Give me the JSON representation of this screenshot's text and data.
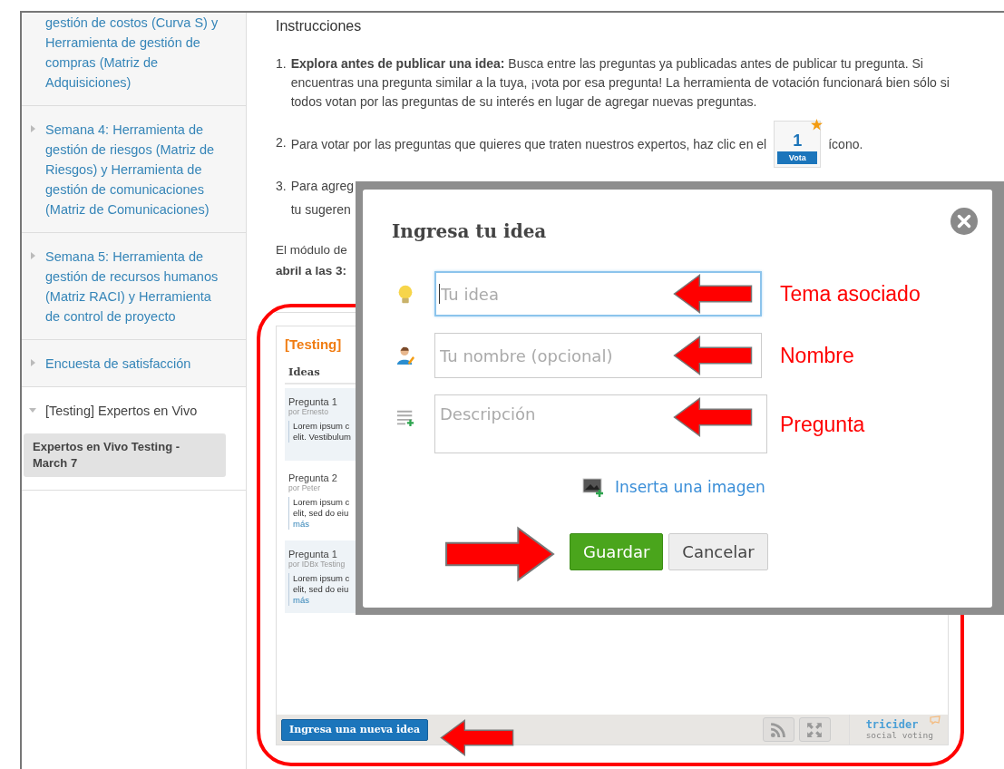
{
  "sidebar": {
    "items": [
      {
        "label": "gestión de costos (Curva S) y Herramienta de gestión de compras (Matriz de Adquisiciones)",
        "expanded": false,
        "caret": false
      },
      {
        "label": "Semana 4: Herramienta de gestión de riesgos (Matriz de Riesgos) y Herramienta de gestión de comunicaciones (Matriz de Comunicaciones)",
        "expanded": false,
        "caret": true
      },
      {
        "label": "Semana 5: Herramienta de gestión de recursos humanos (Matriz RACI) y Herramienta de control de proyecto",
        "expanded": false,
        "caret": true
      },
      {
        "label": "Encuesta de satisfacción",
        "expanded": false,
        "caret": true
      },
      {
        "label": "[Testing] Expertos en Vivo",
        "expanded": true,
        "caret": true,
        "children": [
          {
            "label": "Expertos en Vivo Testing - March 7",
            "selected": true
          }
        ]
      }
    ]
  },
  "instructions": {
    "title": "Instrucciones",
    "steps": [
      {
        "number": "1.",
        "text": "**Explora antes de publicar una idea:** Busca entre las preguntas ya publicadas antes de publicar tu pregunta. Si encuentras una pregunta similar a la tuya, ¡vota por esa pregunta! La herramienta de votación funcionará bien sólo si todos votan por las preguntas de su interés en lugar de agregar nuevas preguntas."
      },
      {
        "number": "2.",
        "text": "Para votar por las preguntas que quieres que traten nuestros expertos, haz clic en el",
        "vote_badge": {
          "count": "1",
          "label": "Vota"
        },
        "after": "ícono."
      },
      {
        "number": "3.",
        "lines": [
          "Para agreg",
          "tu sugeren"
        ]
      }
    ],
    "note": [
      "El módulo de",
      "abril a las 3:"
    ]
  },
  "widget": {
    "title": "[Testing]",
    "heading": "Ideas",
    "ideas": [
      {
        "title": "Pregunta 1",
        "author": "por Ernesto",
        "lines": [
          "Lorem ipsum c",
          "elit. Vestibulum"
        ],
        "highlighted": true
      },
      {
        "title": "Pregunta 2",
        "author": "por Peter",
        "lines": [
          "Lorem ipsum c",
          "elit, sed do eiu"
        ],
        "more": "más",
        "highlighted": false
      },
      {
        "title": "Pregunta 1",
        "author": "por IDBx Testing",
        "lines": [
          "Lorem ipsum c",
          "elit, sed do eiu"
        ],
        "more": "más",
        "highlighted": true
      }
    ],
    "new_idea_button": "Ingresa una nueva idea",
    "brand": {
      "name": "tricider",
      "tagline": "social voting"
    }
  },
  "dialog": {
    "title": "Ingresa tu idea",
    "fields": [
      {
        "kind": "input",
        "placeholder": "Tu idea",
        "focused": true
      },
      {
        "kind": "input",
        "placeholder": "Tu nombre (opcional)",
        "focused": false
      },
      {
        "kind": "textarea",
        "placeholder": "Descripción",
        "focused": false
      }
    ],
    "image_link": "Inserta una imagen",
    "buttons": [
      {
        "label": "Guardar",
        "primary": true
      },
      {
        "label": "Cancelar",
        "primary": false
      }
    ]
  },
  "annotations": {
    "labels": [
      "Tema asociado",
      "Nombre",
      "Pregunta"
    ]
  }
}
